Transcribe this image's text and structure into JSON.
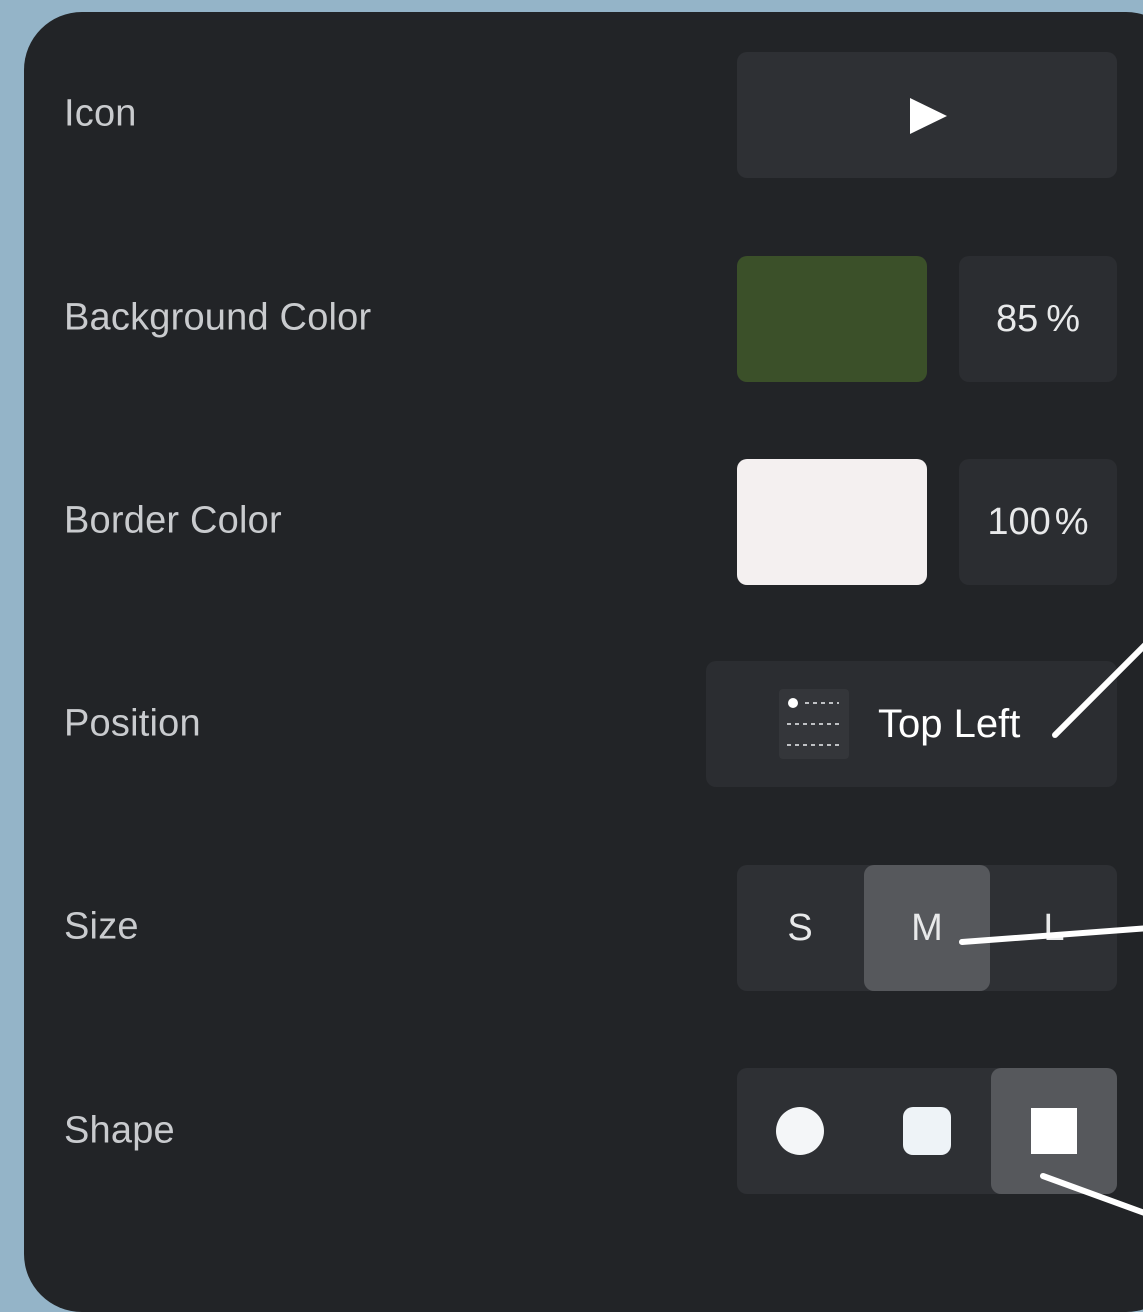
{
  "rows": {
    "icon": {
      "label": "Icon",
      "value_icon": "play-icon"
    },
    "background_color": {
      "label": "Background Color",
      "swatch": "#3b5029",
      "opacity": "85",
      "unit": "%"
    },
    "border_color": {
      "label": "Border Color",
      "swatch": "#f4f0f0",
      "opacity": "100",
      "unit": "%"
    },
    "position": {
      "label": "Position",
      "value": "Top Left",
      "icon": "position-grid-icon"
    },
    "size": {
      "label": "Size",
      "options": [
        "S",
        "M",
        "L"
      ],
      "selected": "M"
    },
    "shape": {
      "label": "Shape",
      "options": [
        "circle",
        "rounded-square",
        "square"
      ],
      "selected": "square"
    }
  },
  "colors": {
    "page_background": "#94b4c8",
    "panel": "#222427",
    "control": "#2e3034",
    "active": "#56585c"
  }
}
